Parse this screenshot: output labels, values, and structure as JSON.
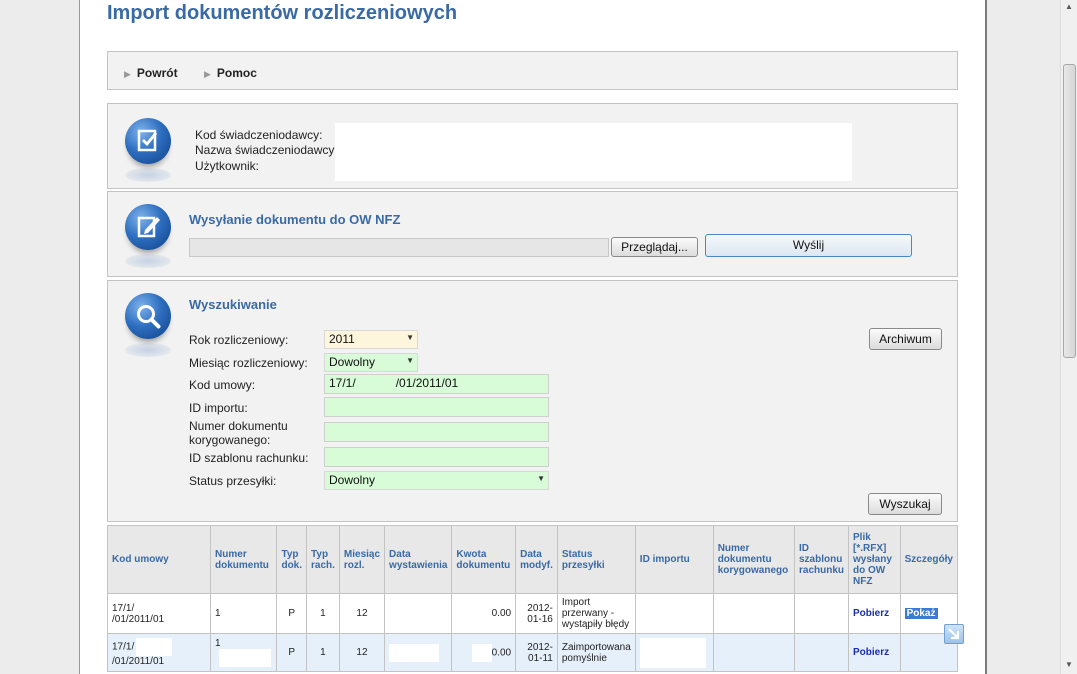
{
  "page": {
    "title": "Import dokumentów rozliczeniowych"
  },
  "nav": {
    "back_label": "Powrót",
    "help_label": "Pomoc"
  },
  "info": {
    "code_label": "Kod świadczeniodawcy:",
    "name_label": "Nazwa świadczeniodawcy:",
    "user_label": "Użytkownik:"
  },
  "send": {
    "title": "Wysyłanie dokumentu do OW NFZ",
    "browse_label": "Przeglądaj...",
    "send_label": "Wyślij"
  },
  "search": {
    "title": "Wyszukiwanie",
    "year_label": "Rok rozliczeniowy:",
    "year_value": "2011",
    "month_label": "Miesiąc rozliczeniowy:",
    "month_value": "Dowolny",
    "contract_label": "Kod umowy:",
    "contract_value_a": "17/1/",
    "contract_value_b": "/01/2011/01",
    "import_id_label": "ID importu:",
    "correction_label": "Numer dokumentu korygowanego:",
    "template_label": "ID szablonu rachunku:",
    "status_label": "Status przesyłki:",
    "status_value": "Dowolny",
    "archive_label": "Archiwum",
    "search_label": "Wyszukaj"
  },
  "table": {
    "headers": [
      "Kod umowy",
      "Numer dokumentu",
      "Typ dok.",
      "Typ rach.",
      "Miesiąc rozl.",
      "Data wystawienia",
      "Kwota dokumentu",
      "Data modyf.",
      "Status przesyłki",
      "ID importu",
      "Numer dokumentu korygowanego",
      "ID szablonu rachunku",
      "Plik [*.RFX] wysłany do OW NFZ",
      "Szczegóły"
    ],
    "rows": [
      {
        "contract_a": "17/1/",
        "contract_b": "/01/2011/01",
        "doc_number": "1",
        "doc_type": "P",
        "bill_type": "1",
        "month": "12",
        "issue_date": "",
        "amount": "0.00",
        "modified": "2012-01-16",
        "status": "Import przerwany - wystąpiły błędy",
        "import_id": "",
        "correction": "",
        "template_id": "",
        "file_link": "Pobierz",
        "details_link": "Pokaż"
      },
      {
        "contract_a": "17/1/",
        "contract_b": "/01/2011/01",
        "doc_number": "1",
        "doc_type": "P",
        "bill_type": "1",
        "month": "12",
        "issue_date": "",
        "amount": "0.00",
        "modified": "2012-01-11",
        "status": "Zaimportowana pomyślnie",
        "import_id": "",
        "correction": "",
        "template_id": "",
        "file_link": "Pobierz",
        "details_link": ""
      }
    ]
  },
  "colors": {
    "accent": "#3a6aa5",
    "error": "#d01010",
    "ok": "#1e8c1e",
    "link": "#1b2fa8"
  }
}
